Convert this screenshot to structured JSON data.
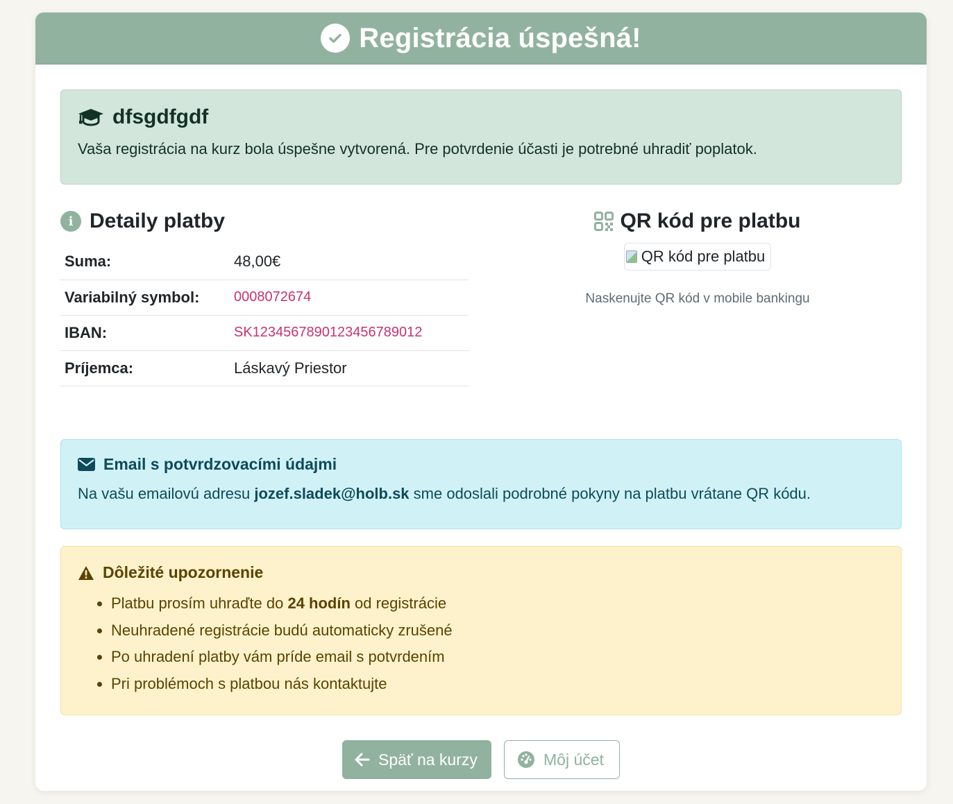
{
  "header": {
    "title": "Registrácia úspešná!"
  },
  "course": {
    "name": "dfsgdfgdf",
    "message": "Vaša registrácia na kurz bola úspešne vytvorená. Pre potvrdenie účasti je potrebné uhradiť poplatok."
  },
  "payment": {
    "title": "Detaily platby",
    "rows": [
      {
        "label": "Suma:",
        "value": "48,00€"
      },
      {
        "label": "Variabilný symbol:",
        "value": "0008072674"
      },
      {
        "label": "IBAN:",
        "value": "SK1234567890123456789012"
      },
      {
        "label": "Príjemca:",
        "value": "Láskavý Priestor"
      }
    ]
  },
  "qr": {
    "title": "QR kód pre platbu",
    "alt": "QR kód pre platbu",
    "hint": "Naskenujte QR kód v mobile bankingu"
  },
  "email_alert": {
    "title": "Email s potvrdzovacími údajmi",
    "text_before": "Na vašu emailovú adresu ",
    "email": "jozef.sladek@holb.sk",
    "text_after": " sme odoslali podrobné pokyny na platbu vrátane QR kódu."
  },
  "warning": {
    "title": "Dôležité upozornenie",
    "item1_before": "Platbu prosím uhraďte do ",
    "item1_bold": "24 hodín",
    "item1_after": " od registrácie",
    "item2": "Neuhradené registrácie budú automaticky zrušené",
    "item3": "Po uhradení platby vám príde email s potvrdením",
    "item4": "Pri problémoch s platbou nás kontaktujte"
  },
  "buttons": {
    "back": "Späť na kurzy",
    "account": "Môj účet"
  },
  "colors": {
    "accent": "#91b29f",
    "code": "#c7336f",
    "info_bg": "#d0f2f7",
    "warning_bg": "#fdf2cb",
    "success_bg": "#d3e6dc"
  }
}
